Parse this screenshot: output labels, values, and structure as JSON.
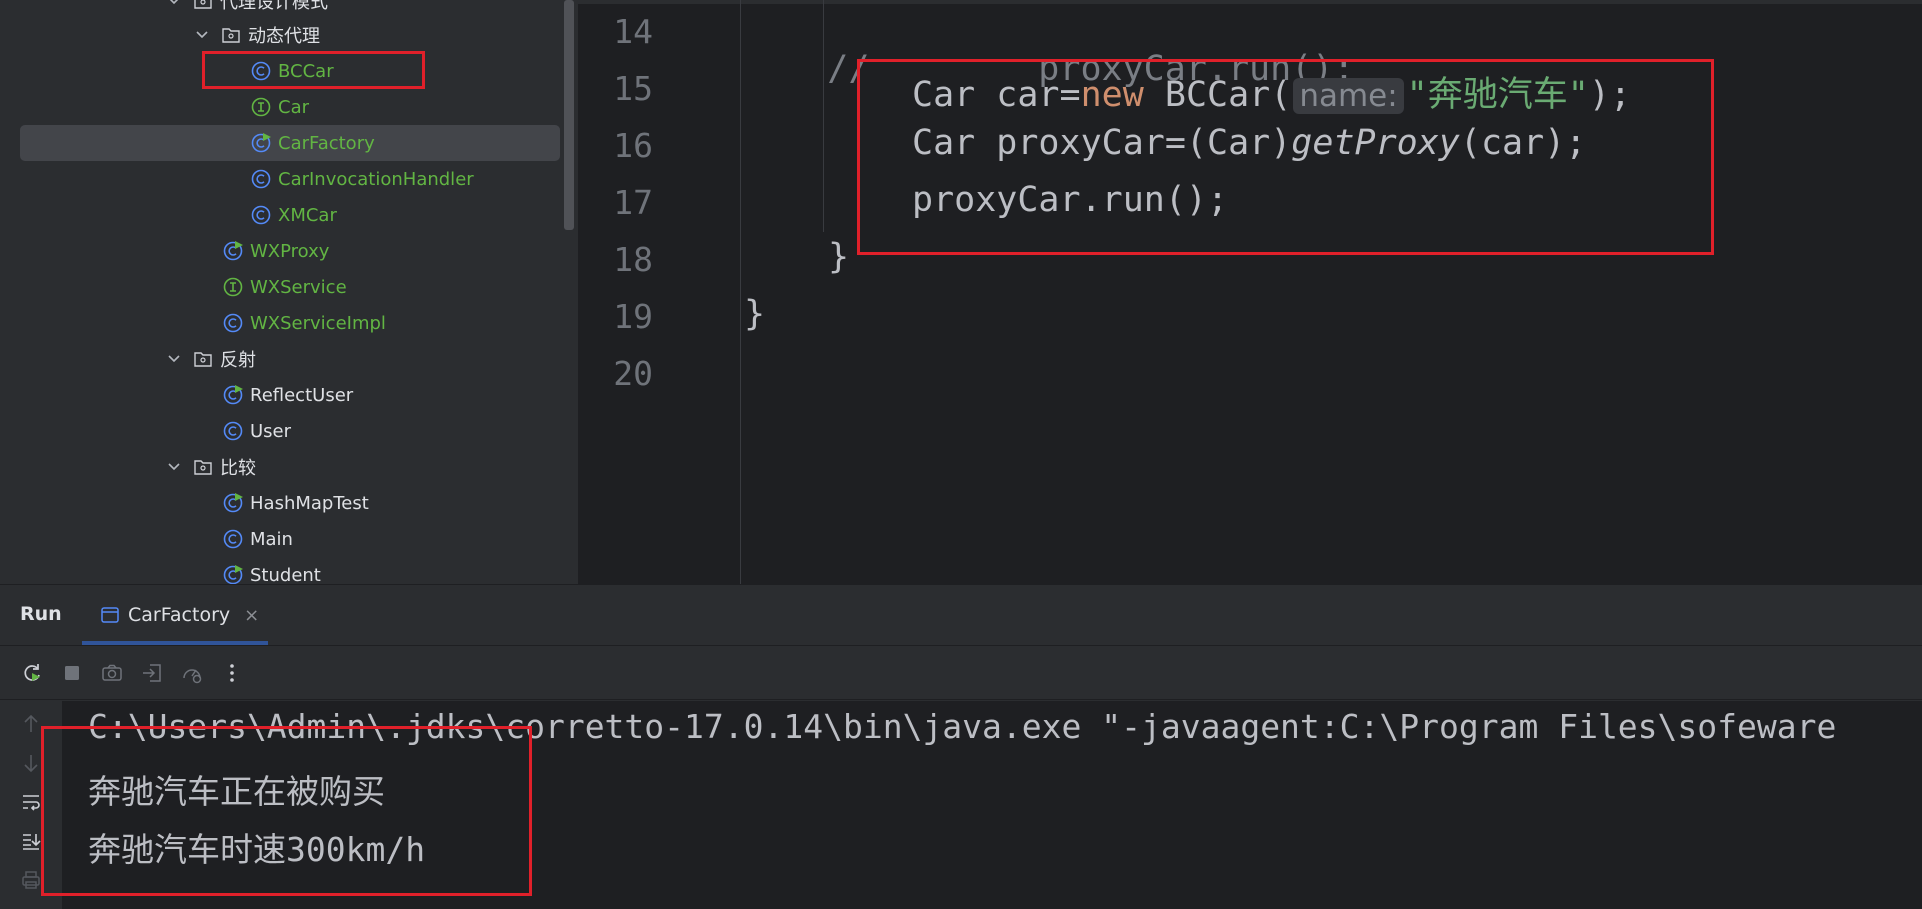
{
  "project_tree": {
    "items": [
      {
        "label": "代理设计模式",
        "kind": "folder",
        "expanded": true,
        "color": "#dfe1e5"
      },
      {
        "label": "动态代理",
        "kind": "folder",
        "expanded": true,
        "color": "#dfe1e5"
      },
      {
        "label": "BCCar",
        "kind": "class",
        "color": "#62b543"
      },
      {
        "label": "Car",
        "kind": "interface",
        "color": "#62b543"
      },
      {
        "label": "CarFactory",
        "kind": "runnable-class",
        "color": "#62b543",
        "selected": true
      },
      {
        "label": "CarInvocationHandler",
        "kind": "class",
        "color": "#62b543"
      },
      {
        "label": "XMCar",
        "kind": "class",
        "color": "#62b543"
      },
      {
        "label": "WXProxy",
        "kind": "runnable-class",
        "color": "#62b543"
      },
      {
        "label": "WXService",
        "kind": "interface",
        "color": "#62b543"
      },
      {
        "label": "WXServiceImpl",
        "kind": "class",
        "color": "#62b543"
      },
      {
        "label": "反射",
        "kind": "folder",
        "expanded": true,
        "color": "#dfe1e5"
      },
      {
        "label": "ReflectUser",
        "kind": "runnable-class",
        "color": "#dfe1e5"
      },
      {
        "label": "User",
        "kind": "class",
        "color": "#dfe1e5"
      },
      {
        "label": "比较",
        "kind": "folder",
        "expanded": true,
        "color": "#dfe1e5"
      },
      {
        "label": "HashMapTest",
        "kind": "runnable-class",
        "color": "#dfe1e5"
      },
      {
        "label": "Main",
        "kind": "class",
        "color": "#dfe1e5"
      },
      {
        "label": "Student",
        "kind": "runnable-class",
        "color": "#dfe1e5"
      }
    ]
  },
  "editor": {
    "line_numbers": [
      "14",
      "15",
      "16",
      "17",
      "18",
      "19",
      "20"
    ],
    "lines": {
      "l14_comment": "//",
      "l14_code": "proxyCar.run();",
      "l15_type": "Car car=",
      "l15_kw": "new",
      "l15_call": " BCCar(",
      "l15_hint": "name:",
      "l15_str": "\"奔驰汽车\"",
      "l15_end": ");",
      "l16_a": "Car proxyCar=(Car)",
      "l16_method": "getProxy",
      "l16_b": "(car);",
      "l17": "proxyCar.run();",
      "l18": "}",
      "l19": "}"
    }
  },
  "run_panel": {
    "title": "Run",
    "tab_label": "CarFactory",
    "tab_close": "×",
    "console_lines": [
      "C:\\Users\\Admin\\.jdks\\corretto-17.0.14\\bin\\java.exe \"-javaagent:C:\\Program Files\\sofeware",
      "奔驰汽车正在被购买",
      "奔驰汽车时速300km/h"
    ]
  },
  "colors": {
    "accent": "#3574f0",
    "annotation": "#e0202a",
    "class_icon": "#548af7",
    "interface_icon": "#62b543"
  }
}
